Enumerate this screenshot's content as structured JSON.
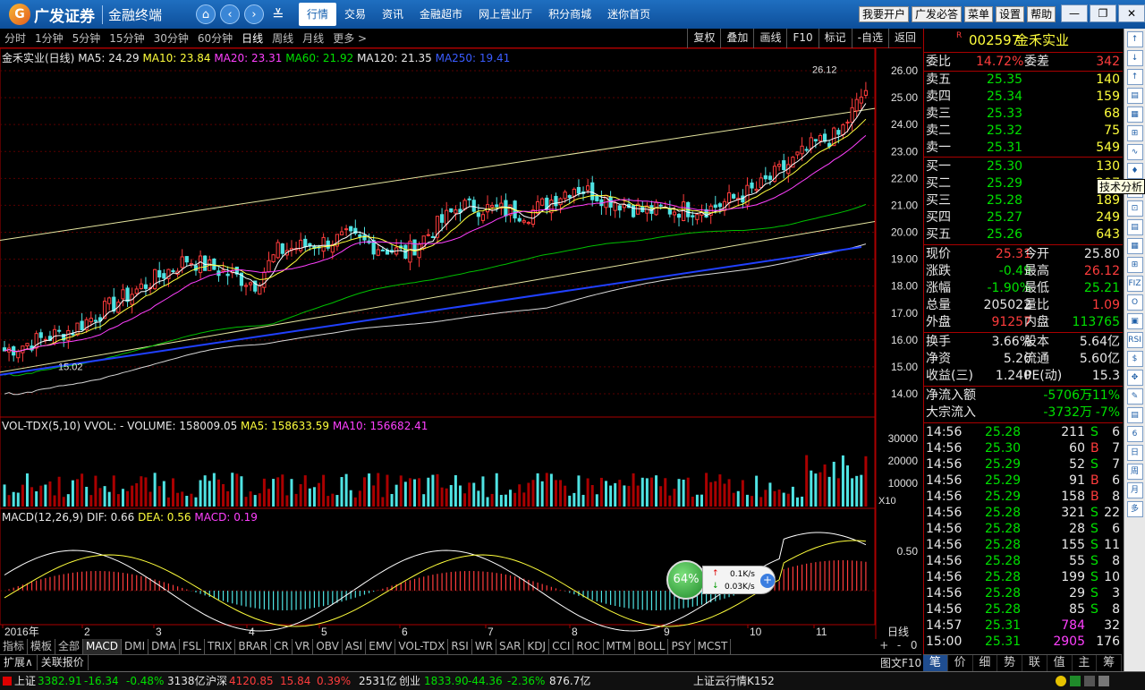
{
  "app": {
    "brand": "广发证券",
    "subtitle": "金融终端",
    "nav": [
      "行情",
      "交易",
      "资讯",
      "金融超市",
      "网上营业厅",
      "积分商城",
      "迷你首页"
    ],
    "nav_active": 0,
    "toolbuttons": [
      "我要开户",
      "广发必答",
      "菜单",
      "设置",
      "帮助"
    ]
  },
  "periods": {
    "items": [
      "分时",
      "1分钟",
      "5分钟",
      "15分钟",
      "30分钟",
      "60分钟",
      "日线",
      "周线",
      "月线",
      "更多 >"
    ],
    "active": 6,
    "chart_buttons": [
      "复权",
      "叠加",
      "画线",
      "F10",
      "标记",
      "-自选",
      "返回"
    ]
  },
  "main_legend": {
    "name": "金禾实业(日线)",
    "ma5": "MA5: 24.29",
    "ma10": "MA10: 23.84",
    "ma20": "MA20: 23.31",
    "ma60": "MA60: 21.92",
    "ma120": "MA120: 21.35",
    "ma250": "MA250: 19.41"
  },
  "main_chart": {
    "y_ticks": [
      "26.00",
      "25.00",
      "24.00",
      "23.00",
      "22.00",
      "21.00",
      "20.00",
      "19.00",
      "18.00",
      "17.00",
      "16.00",
      "15.00",
      "14.00"
    ],
    "high_label": "26.12",
    "low_label": "15.02"
  },
  "vol_legend": {
    "name": "VOL-TDX(5,10)",
    "vvol": "VVOL: -",
    "volume": "VOLUME: 158009.05",
    "ma5": "MA5: 158633.59",
    "ma10": "MA10: 156682.41",
    "y_ticks": [
      "30000",
      "20000",
      "10000"
    ],
    "unit": "X10"
  },
  "macd_legend": {
    "name": "MACD(12,26,9)",
    "dif": "DIF: 0.66",
    "dea": "DEA: 0.56",
    "macd": "MACD: 0.19",
    "y_tick": "0.50"
  },
  "x_axis": {
    "labels": [
      "2016年",
      "2",
      "3",
      "4",
      "5",
      "6",
      "7",
      "8",
      "9",
      "10",
      "11"
    ],
    "period": "日线"
  },
  "indicator_tabs": [
    "指标",
    "模板",
    "全部",
    "MACD",
    "DMI",
    "DMA",
    "FSL",
    "TRIX",
    "BRAR",
    "CR",
    "VR",
    "OBV",
    "ASI",
    "EMV",
    "VOL-TDX",
    "RSI",
    "WR",
    "SAR",
    "KDJ",
    "CCI",
    "ROC",
    "MTM",
    "BOLL",
    "PSY",
    "MCST"
  ],
  "indicator_active": 3,
  "zoom_controls": [
    "+",
    "-",
    "0"
  ],
  "expand_tabs": [
    "扩展∧",
    "关联报价"
  ],
  "quote": {
    "marker": "R",
    "code": "002597",
    "name": "金禾实业",
    "weibi_label": "委比",
    "weibi": "14.72%",
    "weicha_label": "委差",
    "weicha": "342",
    "asks": [
      {
        "label": "卖五",
        "price": "25.35",
        "vol": "140"
      },
      {
        "label": "卖四",
        "price": "25.34",
        "vol": "159"
      },
      {
        "label": "卖三",
        "price": "25.33",
        "vol": "68"
      },
      {
        "label": "卖二",
        "price": "25.32",
        "vol": "75"
      },
      {
        "label": "卖一",
        "price": "25.31",
        "vol": "549"
      }
    ],
    "bids": [
      {
        "label": "买一",
        "price": "25.30",
        "vol": "130"
      },
      {
        "label": "买二",
        "price": "25.29",
        "vol": "207"
      },
      {
        "label": "买三",
        "price": "25.28",
        "vol": "189"
      },
      {
        "label": "买四",
        "price": "25.27",
        "vol": "249"
      },
      {
        "label": "买五",
        "price": "25.26",
        "vol": "643"
      }
    ],
    "stats": [
      {
        "l1": "现价",
        "v1": "25.31",
        "c1": "red",
        "l2": "今开",
        "v2": "25.80",
        "c2": "wht"
      },
      {
        "l1": "涨跌",
        "v1": "-0.49",
        "c1": "green",
        "l2": "最高",
        "v2": "26.12",
        "c2": "red"
      },
      {
        "l1": "涨幅",
        "v1": "-1.90%",
        "c1": "green",
        "l2": "最低",
        "v2": "25.21",
        "c2": "green"
      },
      {
        "l1": "总量",
        "v1": "205022",
        "c1": "wht",
        "l2": "量比",
        "v2": "1.09",
        "c2": "red"
      },
      {
        "l1": "外盘",
        "v1": "91257",
        "c1": "red",
        "l2": "内盘",
        "v2": "113765",
        "c2": "green"
      }
    ],
    "fund": [
      {
        "l1": "换手",
        "v1": "3.66%",
        "l2": "股本",
        "v2": "5.64亿"
      },
      {
        "l1": "净资",
        "v1": "5.26",
        "l2": "流通",
        "v2": "5.60亿"
      },
      {
        "l1": "收益(三)",
        "v1": "1.240",
        "l2": "PE(动)",
        "v2": "15.3"
      }
    ],
    "flow": [
      {
        "label": "净流入额",
        "value": "-5706万",
        "pct": "-11%"
      },
      {
        "label": "大宗流入",
        "value": "-3732万",
        "pct": "-7%"
      }
    ],
    "ticks": [
      {
        "t": "14:56",
        "p": "25.28",
        "v": "211",
        "d": "S",
        "n": "6"
      },
      {
        "t": "14:56",
        "p": "25.30",
        "v": "60",
        "d": "B",
        "n": "7"
      },
      {
        "t": "14:56",
        "p": "25.29",
        "v": "52",
        "d": "S",
        "n": "7"
      },
      {
        "t": "14:56",
        "p": "25.29",
        "v": "91",
        "d": "B",
        "n": "6"
      },
      {
        "t": "14:56",
        "p": "25.29",
        "v": "158",
        "d": "B",
        "n": "8"
      },
      {
        "t": "14:56",
        "p": "25.28",
        "v": "321",
        "d": "S",
        "n": "22"
      },
      {
        "t": "14:56",
        "p": "25.28",
        "v": "28",
        "d": "S",
        "n": "6"
      },
      {
        "t": "14:56",
        "p": "25.28",
        "v": "155",
        "d": "S",
        "n": "11"
      },
      {
        "t": "14:56",
        "p": "25.28",
        "v": "55",
        "d": "S",
        "n": "8"
      },
      {
        "t": "14:56",
        "p": "25.28",
        "v": "199",
        "d": "S",
        "n": "10"
      },
      {
        "t": "14:56",
        "p": "25.28",
        "v": "29",
        "d": "S",
        "n": "3"
      },
      {
        "t": "14:56",
        "p": "25.28",
        "v": "85",
        "d": "S",
        "n": "8"
      },
      {
        "t": "14:57",
        "p": "25.31",
        "v": "784",
        "d": "",
        "n": "32"
      },
      {
        "t": "15:00",
        "p": "25.31",
        "v": "2905",
        "d": "",
        "n": "176"
      }
    ],
    "tabs": [
      "笔",
      "价",
      "细",
      "势",
      "联",
      "值",
      "主",
      "筹"
    ]
  },
  "tooltip": "技术分析",
  "f10_label": "图文F10",
  "net": {
    "pct": "64%",
    "up": "0.1K/s",
    "down": "0.03K/s"
  },
  "statusbar": {
    "sh_label": "上证",
    "sh": "3382.91",
    "sh_chg": "-16.34",
    "sh_pct": "-0.48%",
    "sh_amt": "3138亿",
    "hs_label": "沪深",
    "hs": "4120.85",
    "hs_chg": "15.84",
    "hs_pct": "0.39%",
    "hs_amt": "2531亿",
    "cy_label": "创业",
    "cy": "1833.90",
    "cy_chg": "-44.36",
    "cy_pct": "-2.36%",
    "cy_amt": "876.7亿",
    "server": "上证云行情K152"
  }
}
